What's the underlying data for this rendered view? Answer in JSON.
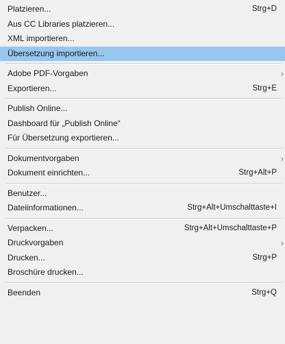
{
  "menu": {
    "groups": [
      [
        {
          "label": "Platzieren...",
          "shortcut": "Strg+D"
        },
        {
          "label": "Aus CC Libraries platzieren...",
          "shortcut": ""
        },
        {
          "label": "XML importieren...",
          "shortcut": ""
        },
        {
          "label": "Übersetzung importieren...",
          "shortcut": ""
        }
      ],
      [
        {
          "label": "Adobe PDF-Vorgaben",
          "shortcut": "",
          "submenu": true
        },
        {
          "label": "Exportieren...",
          "shortcut": "Strg+E"
        }
      ],
      [
        {
          "label": "Publish Online...",
          "shortcut": ""
        },
        {
          "label": "Dashboard für „Publish Online“",
          "shortcut": ""
        },
        {
          "label": "Für Übersetzung exportieren...",
          "shortcut": ""
        }
      ],
      [
        {
          "label": "Dokumentvorgaben",
          "shortcut": "",
          "submenu": true
        },
        {
          "label": "Dokument einrichten...",
          "shortcut": "Strg+Alt+P"
        }
      ],
      [
        {
          "label": "Benutzer...",
          "shortcut": ""
        },
        {
          "label": "Dateiinformationen...",
          "shortcut": "Strg+Alt+Umschalttaste+I"
        }
      ],
      [
        {
          "label": "Verpacken...",
          "shortcut": "Strg+Alt+Umschalttaste+P"
        },
        {
          "label": "Druckvorgaben",
          "shortcut": "",
          "submenu": true
        },
        {
          "label": "Drucken...",
          "shortcut": "Strg+P"
        },
        {
          "label": "Broschüre drucken...",
          "shortcut": ""
        }
      ],
      [
        {
          "label": "Beenden",
          "shortcut": "Strg+Q"
        }
      ]
    ],
    "highlighted": "Übersetzung importieren...",
    "submenu_icon": "chevron-right-icon",
    "colors": {
      "background": "#f0f0f0",
      "highlight": "#97c6ef",
      "text": "#1a1a1a",
      "separator": "#d0d0d0"
    }
  }
}
